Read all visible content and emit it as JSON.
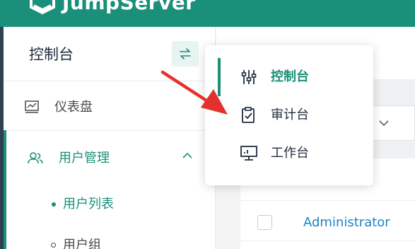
{
  "header": {
    "brand": "JumpServer",
    "color": "#1a8f79"
  },
  "sidebar": {
    "title": "控制台",
    "switch_icon": "swap-arrows-icon",
    "items": [
      {
        "label": "仪表盘",
        "icon": "dashboard-chart-icon"
      },
      {
        "label": "用户管理",
        "icon": "users-icon",
        "expanded": true,
        "active": true
      }
    ],
    "subitems": [
      {
        "label": "用户列表",
        "active": true
      },
      {
        "label": "用户组",
        "active": false
      }
    ]
  },
  "view_switcher": {
    "items": [
      {
        "label": "控制台",
        "icon": "sliders-icon",
        "active": true
      },
      {
        "label": "审计台",
        "icon": "clipboard-check-icon",
        "active": false
      },
      {
        "label": "工作台",
        "icon": "monitor-icon",
        "active": false
      }
    ]
  },
  "table": {
    "rows": [
      {
        "name": "Administrator"
      }
    ]
  },
  "colors": {
    "accent": "#1a8f79",
    "link": "#1c84c6",
    "annotation": "#e5312d"
  }
}
